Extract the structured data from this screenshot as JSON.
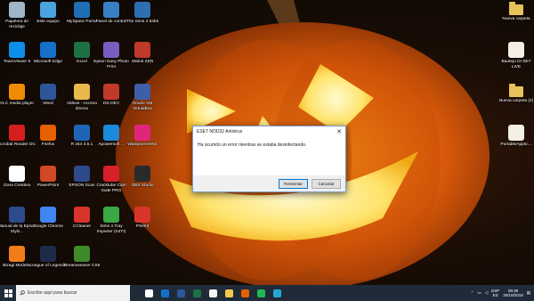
{
  "desktop": {
    "icons_left": [
      {
        "label": "Papelera de reciclaje",
        "icon": "recycle-bin-icon",
        "color": "#9fb7c9"
      },
      {
        "label": "Este equipo",
        "icon": "computer-icon",
        "color": "#4aa3df"
      },
      {
        "label": "MySpace Portal",
        "icon": "globe-icon",
        "color": "#1f6fb5"
      },
      {
        "label": "Panel de control",
        "icon": "control-panel-icon",
        "color": "#3a7fc4"
      },
      {
        "label": "The Sims 4 64bit",
        "icon": "sims-icon",
        "color": "#2c6fb2"
      },
      {
        "label": "TeamViewer 9",
        "icon": "teamviewer-icon",
        "color": "#0e8ee9"
      },
      {
        "label": "Microsoft Edge",
        "icon": "edge-icon",
        "color": "#1570c9"
      },
      {
        "label": "Excel",
        "icon": "excel-icon",
        "color": "#1e7145"
      },
      {
        "label": "Epson Easy Photo Print",
        "icon": "epson-photo-icon",
        "color": "#7a5cc0"
      },
      {
        "label": "XMind ZEN",
        "icon": "xmind-icon",
        "color": "#c0392b"
      },
      {
        "label": "VLC media player",
        "icon": "vlc-icon",
        "color": "#f08a00"
      },
      {
        "label": "Word",
        "icon": "word-icon",
        "color": "#2b579a"
      },
      {
        "label": "Videos - Acceso directo",
        "icon": "videos-folder-icon",
        "color": "#e8b84a"
      },
      {
        "label": "DS-DEV",
        "icon": "target-icon",
        "color": "#c0392b"
      },
      {
        "label": "Oracle VM VirtualBox",
        "icon": "virtualbox-icon",
        "color": "#3d5fa8"
      },
      {
        "label": "Acrobat Reader DC",
        "icon": "acrobat-icon",
        "color": "#d4201c"
      },
      {
        "label": "Firefox",
        "icon": "firefox-icon",
        "color": "#e66000"
      },
      {
        "label": "R x64 3.5.1",
        "icon": "r-icon",
        "color": "#1f65b7"
      },
      {
        "label": "Apowersoft ...",
        "icon": "apowersoft-icon",
        "color": "#1b8ad9"
      },
      {
        "label": "WampServer64",
        "icon": "wamp-icon",
        "color": "#e0267a"
      },
      {
        "label": "Zona Creativa",
        "icon": "zona-creativa-icon",
        "color": "#ffffff"
      },
      {
        "label": "PowerPoint",
        "icon": "powerpoint-icon",
        "color": "#d24726"
      },
      {
        "label": "EPSON Scan",
        "icon": "epson-scan-icon",
        "color": "#2d4a8a"
      },
      {
        "label": "Cracktube Cam Suite PRO",
        "icon": "webcam-icon",
        "color": "#d8202a"
      },
      {
        "label": "OBS Studio",
        "icon": "obs-icon",
        "color": "#2a2a2a"
      },
      {
        "label": "Manual de la Epson Stylo...",
        "icon": "epson-manual-icon",
        "color": "#2d4a8a"
      },
      {
        "label": "Google Chrome",
        "icon": "chrome-icon",
        "color": "#4285f4"
      },
      {
        "label": "CCleaner",
        "icon": "ccleaner-icon",
        "color": "#d8342a"
      },
      {
        "label": "Sims 4 Tray Importer (S4TI)",
        "icon": "sims-tray-icon",
        "color": "#39a842"
      },
      {
        "label": "PSeInt",
        "icon": "pseint-icon",
        "color": "#d8342a"
      },
      {
        "label": "Bizagi Modeler",
        "icon": "bizagi-icon",
        "color": "#f07d1a"
      },
      {
        "label": "League of Legends",
        "icon": "league-icon",
        "color": "#1c2b4a"
      },
      {
        "label": "Dreamweaver CS6",
        "icon": "dreamweaver-icon",
        "color": "#3f8a2b"
      }
    ],
    "icons_right": [
      {
        "label": "Nueva carpeta",
        "icon": "folder-icon",
        "color": "#e8c15a"
      },
      {
        "label": "Bautejo DI SET LIVE",
        "icon": "file-icon",
        "color": "#f3efe2"
      },
      {
        "label": "Nueva carpeta (2)",
        "icon": "folder-icon",
        "color": "#e8c15a"
      },
      {
        "label": "PortableAppsc...",
        "icon": "portableapps-icon",
        "color": "#f3efe2"
      }
    ]
  },
  "dialog": {
    "title": "ESET NOD32 Antivirus",
    "close_label": "✕",
    "message": "Ha ocurrido un error mientras se estaba desinfectando.",
    "buttons": {
      "retry": "Reintentar",
      "cancel": "Cancelar"
    }
  },
  "taskbar": {
    "search_placeholder": "Escribe aquí para buscar",
    "apps": [
      {
        "icon": "task-view-icon",
        "color": "#ffffff"
      },
      {
        "icon": "edge-icon",
        "color": "#1570c9"
      },
      {
        "icon": "word-icon",
        "color": "#2b579a"
      },
      {
        "icon": "excel-icon",
        "color": "#1e7145"
      },
      {
        "icon": "store-icon",
        "color": "#f5f5f5"
      },
      {
        "icon": "file-explorer-icon",
        "color": "#f2c94c"
      },
      {
        "icon": "firefox-icon",
        "color": "#e66000"
      },
      {
        "icon": "spotify-icon",
        "color": "#1db954"
      },
      {
        "icon": "eset-icon",
        "color": "#24a9d3"
      }
    ],
    "tray": {
      "language_top": "ESP",
      "language_bottom": "ES",
      "time": "09:38",
      "date": "30/10/2019"
    }
  }
}
